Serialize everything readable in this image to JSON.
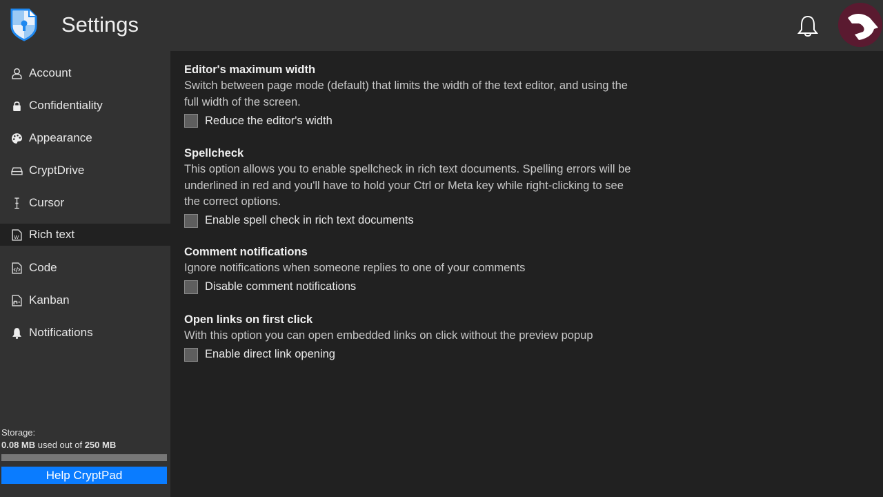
{
  "header": {
    "title": "Settings"
  },
  "sidebar": {
    "items": [
      {
        "label": "Account",
        "icon": "user-icon"
      },
      {
        "label": "Confidentiality",
        "icon": "lock-icon"
      },
      {
        "label": "Appearance",
        "icon": "palette-icon"
      },
      {
        "label": "CryptDrive",
        "icon": "drive-icon"
      },
      {
        "label": "Cursor",
        "icon": "text-cursor-icon"
      },
      {
        "label": "Rich text",
        "icon": "rich-text-file-icon",
        "active": true
      },
      {
        "label": "Code",
        "icon": "code-file-icon"
      },
      {
        "label": "Kanban",
        "icon": "kanban-file-icon"
      },
      {
        "label": "Notifications",
        "icon": "bell-icon"
      }
    ],
    "storage": {
      "label": "Storage:",
      "used": "0.08 MB",
      "middle": " used out of ",
      "total": "250 MB",
      "fraction": 0.0003
    },
    "help_label": "Help CryptPad"
  },
  "sections": [
    {
      "title": "Editor's maximum width",
      "desc": "Switch between page mode (default) that limits the width of the text editor, and using the full width of the screen.",
      "checkbox": "Reduce the editor's width",
      "checked": false
    },
    {
      "title": "Spellcheck",
      "desc": "This option allows you to enable spellcheck in rich text documents. Spelling errors will be underlined in red and you'll have to hold your Ctrl or Meta key while right-clicking to see the correct options.",
      "checkbox": "Enable spell check in rich text documents",
      "checked": false
    },
    {
      "title": "Comment notifications",
      "desc": "Ignore notifications when someone replies to one of your comments",
      "checkbox": "Disable comment notifications",
      "checked": false
    },
    {
      "title": "Open links on first click",
      "desc": "With this option you can open embedded links on click without the preview popup",
      "checkbox": "Enable direct link opening",
      "checked": false
    }
  ]
}
